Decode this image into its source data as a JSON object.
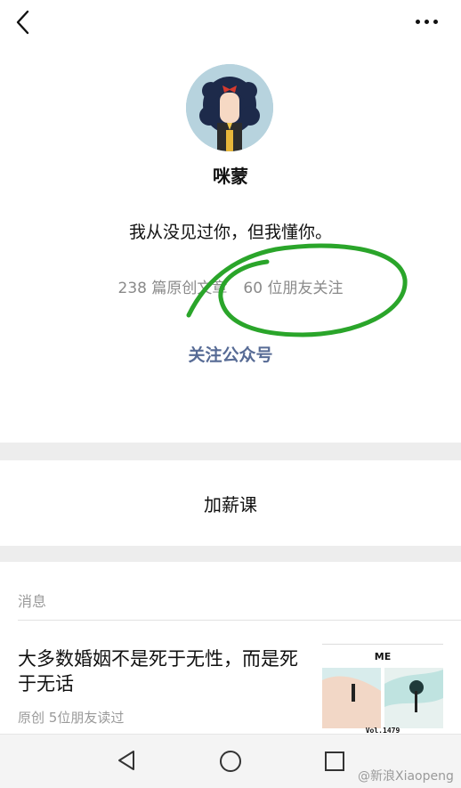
{
  "header": {
    "back_icon": "back-arrow-icon",
    "more_icon": "more-dots-icon"
  },
  "profile": {
    "name": "咪蒙",
    "bio": "我从没见过你，但我懂你。",
    "original_articles": "238 篇原创文章",
    "friends_following": "60 位朋友关注",
    "follow_label": "关注公众号",
    "highlight_color": "#2aa52a",
    "link_color": "#576b95"
  },
  "menu": {
    "label": "加薪课"
  },
  "messages": {
    "section_title": "消息",
    "article": {
      "title": "大多数婚姻不是死于无性，而是死于无话",
      "tag": "原创",
      "read_info": "5位朋友读过",
      "thumb_title": "ME",
      "thumb_vol": "Vol.1479"
    }
  },
  "system_nav": {
    "back_icon": "nav-back-icon",
    "home_icon": "nav-home-icon",
    "recent_icon": "nav-recent-icon"
  },
  "watermark": "@新浪Xiaopeng"
}
